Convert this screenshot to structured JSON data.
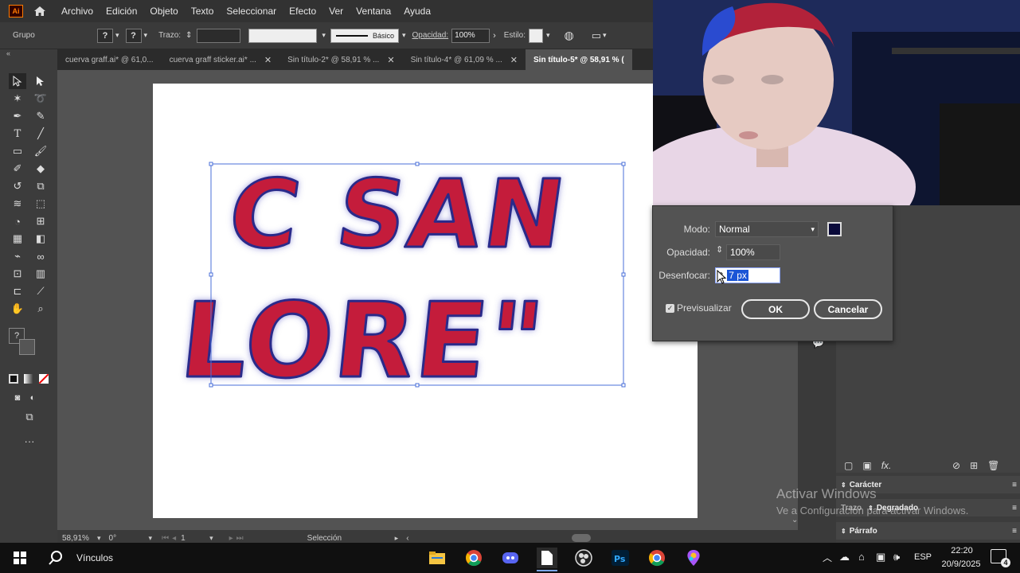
{
  "menubar": {
    "app_icon": "Ai",
    "items": [
      "Archivo",
      "Edición",
      "Objeto",
      "Texto",
      "Seleccionar",
      "Efecto",
      "Ver",
      "Ventana",
      "Ayuda"
    ]
  },
  "controlbar": {
    "selection_type": "Grupo",
    "stroke_label": "Trazo:",
    "stroke_profile": "Básico",
    "opacity_label": "Opacidad:",
    "opacity_value": "100%",
    "style_label": "Estilo:"
  },
  "tabs": [
    {
      "label": "cuerva graff.ai* @ 61,0...",
      "active": false
    },
    {
      "label": "cuerva graff sticker.ai* ...",
      "active": false
    },
    {
      "label": "Sin título-2* @ 58,91 % ...",
      "active": false
    },
    {
      "label": "Sin título-4* @ 61,09 % ...",
      "active": false
    },
    {
      "label": "Sin título-5* @ 58,91 % (",
      "active": true
    }
  ],
  "artwork": {
    "line1": "C SAN",
    "line2": "LORE\"",
    "fill_color": "#c41f3a",
    "stroke_color": "#2a2a8a"
  },
  "statusbar": {
    "zoom": "58,91%",
    "rotation": "0°",
    "artboard_number": "1",
    "tool_name": "Selección"
  },
  "dialog": {
    "mode_label": "Modo:",
    "mode_value": "Normal",
    "swatch_color": "#0a0a3a",
    "opacity_label": "Opacidad:",
    "opacity_value": "100%",
    "blur_label": "Desenfocar:",
    "blur_value": "7 px",
    "preview_label": "Previsualizar",
    "preview_checked": true,
    "ok_label": "OK",
    "cancel_label": "Cancelar"
  },
  "right_panels": {
    "caracter": "Carácter",
    "trazo": "Trazo",
    "degradado": "Degradado",
    "parrafo": "Párrafo"
  },
  "watermark": {
    "title": "Activar Windows",
    "subtitle": "Ve a Configuración para activar Windows."
  },
  "taskbar": {
    "search_text": "Vínculos",
    "language": "ESP",
    "time": "22:20",
    "date": "20/9/2025",
    "notification_count": "4"
  }
}
